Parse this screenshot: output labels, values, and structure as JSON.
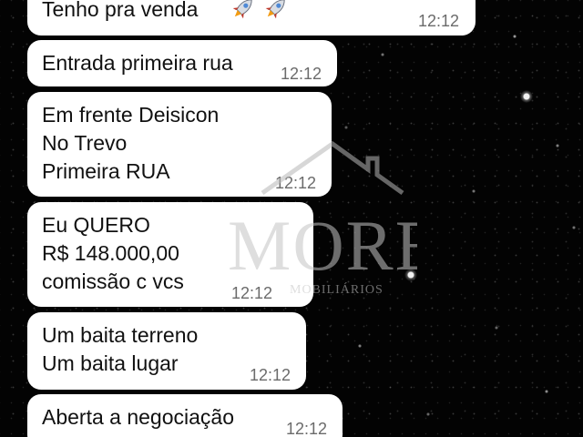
{
  "chat": {
    "messages": [
      {
        "lines": [
          "Tenho pra venda"
        ],
        "time": "12:12",
        "trailing_icons": [
          "rocket-icon",
          "rocket-icon"
        ]
      },
      {
        "lines": [
          "Entrada primeira rua"
        ],
        "time": "12:12"
      },
      {
        "lines": [
          "Em frente Deisicon",
          "No Trevo",
          "Primeira RUA"
        ],
        "time": "12:12"
      },
      {
        "lines": [
          "Eu QUERO",
          "R$ 148.000,00",
          "comissão c vcs"
        ],
        "time": "12:12"
      },
      {
        "lines": [
          "Um baita terreno",
          "Um baita lugar"
        ],
        "time": "12:12"
      },
      {
        "lines": [
          "Aberta a negociação"
        ],
        "time": "12:12"
      }
    ]
  },
  "watermark": {
    "word": "MORE",
    "subtitle": "MOBILIÁRIOS"
  },
  "colors": {
    "bubble": "#ffffff",
    "timestamp": "#6b6b6b",
    "background": "#000000"
  }
}
